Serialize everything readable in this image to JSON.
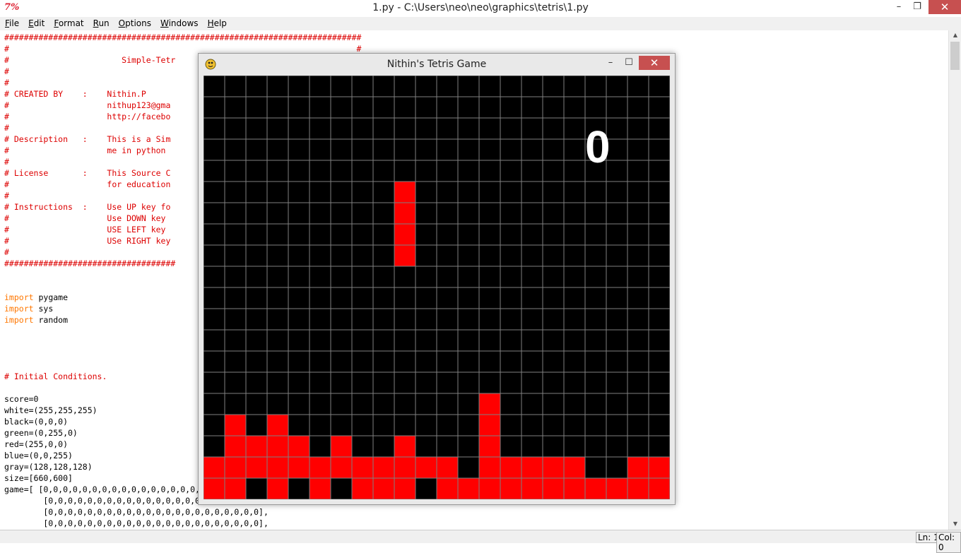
{
  "idle": {
    "window_title": "1.py - C:\\Users\\neo\\neo\\graphics\\tetris\\1.py",
    "logo": "7%",
    "controls": {
      "minimize": "–",
      "restore": "❐",
      "close": "✕"
    },
    "menu": [
      {
        "label": "File",
        "key": "F",
        "rest": "ile"
      },
      {
        "label": "Edit",
        "key": "E",
        "rest": "dit"
      },
      {
        "label": "Format",
        "key": "F",
        "pre": "",
        "rest": "ormat"
      },
      {
        "label": "Run",
        "key": "R",
        "rest": "un"
      },
      {
        "label": "Options",
        "key": "O",
        "rest": "ptions"
      },
      {
        "label": "Windows",
        "key": "W",
        "rest": "indows"
      },
      {
        "label": "Help",
        "key": "H",
        "rest": "elp"
      }
    ],
    "code_lines": [
      {
        "t": "#########################################################################",
        "c": "c"
      },
      {
        "t": "#                                                                       #",
        "c": "c"
      },
      {
        "t": "#                       Simple-Tetr",
        "c": "c"
      },
      {
        "t": "#",
        "c": "c"
      },
      {
        "t": "#",
        "c": "c"
      },
      {
        "t": "# CREATED BY    :    Nithin.P",
        "c": "c"
      },
      {
        "t": "#                    nithup123@gma",
        "c": "c"
      },
      {
        "t": "#                    http://facebo",
        "c": "c"
      },
      {
        "t": "#",
        "c": "c"
      },
      {
        "t": "# Description   :    This is a Sim",
        "c": "c"
      },
      {
        "t": "#                    me in python",
        "c": "c"
      },
      {
        "t": "#",
        "c": "c"
      },
      {
        "t": "# License       :    This Source C",
        "c": "c"
      },
      {
        "t": "#                    for education",
        "c": "c"
      },
      {
        "t": "#",
        "c": "c"
      },
      {
        "t": "# Instructions  :    Use UP key fo",
        "c": "c"
      },
      {
        "t": "#                    Use DOWN key",
        "c": "c"
      },
      {
        "t": "#                    USE LEFT key",
        "c": "c"
      },
      {
        "t": "#                    USe RIGHT key",
        "c": "c"
      },
      {
        "t": "#",
        "c": "c"
      },
      {
        "t": "###################################",
        "c": "c"
      },
      {
        "t": "",
        "c": ""
      },
      {
        "t": "",
        "c": ""
      },
      {
        "kw": "import",
        "t": " pygame"
      },
      {
        "kw": "import",
        "t": " sys"
      },
      {
        "kw": "import",
        "t": " random"
      },
      {
        "t": "",
        "c": ""
      },
      {
        "t": "",
        "c": ""
      },
      {
        "t": "",
        "c": ""
      },
      {
        "t": "",
        "c": ""
      },
      {
        "t": "# Initial Conditions.",
        "c": "c"
      },
      {
        "t": "",
        "c": ""
      },
      {
        "t": "score=0",
        "c": ""
      },
      {
        "t": "white=(255,255,255)",
        "c": ""
      },
      {
        "t": "black=(0,0,0)",
        "c": ""
      },
      {
        "t": "green=(0,255,0)",
        "c": ""
      },
      {
        "t": "red=(255,0,0)",
        "c": ""
      },
      {
        "t": "blue=(0,0,255)",
        "c": ""
      },
      {
        "t": "gray=(128,128,128)",
        "c": ""
      },
      {
        "t": "size=[660,600]",
        "c": ""
      },
      {
        "t": "game=[ [0,0,0,0,0,0,0,0,0,0,0,0,0,0,0,0,0,0,0,0,0,0],",
        "c": ""
      },
      {
        "t": "        [0,0,0,0,0,0,0,0,0,0,0,0,0,0,0,0,0,0,0,0,0,0],",
        "c": ""
      },
      {
        "t": "        [0,0,0,0,0,0,0,0,0,0,0,0,0,0,0,0,0,0,0,0,0,0],",
        "c": ""
      },
      {
        "t": "        [0,0,0,0,0,0,0,0,0,0,0,0,0,0,0,0,0,0,0,0,0,0],",
        "c": ""
      }
    ],
    "status": {
      "line": "Ln: 1",
      "col": "Col: 0"
    }
  },
  "game": {
    "window_title": "Nithin's Tetris Game",
    "controls": {
      "minimize": "–",
      "maximize": "☐",
      "close": "✕"
    },
    "score": "0",
    "colors": {
      "block": "#ff0000",
      "background": "#000000",
      "grid": "#808080"
    },
    "board": [
      "0000000000000000000000",
      "0000000000000000000000",
      "0000000000000000000000",
      "0000000000000000000000",
      "0000000000000000000000",
      "0000000001000000000000",
      "0000000001000000000000",
      "0000000001000000000000",
      "0000000001000000000000",
      "0000000000000000000000",
      "0000000000000000000000",
      "0000000000000000000000",
      "0000000000000000000000",
      "0000000000000000000000",
      "0000000000000000000000",
      "0000000000000100000000",
      "0101000000000100000000",
      "0111101001000100000000",
      "1111111111110111110011",
      "1101010111011111111111"
    ]
  }
}
